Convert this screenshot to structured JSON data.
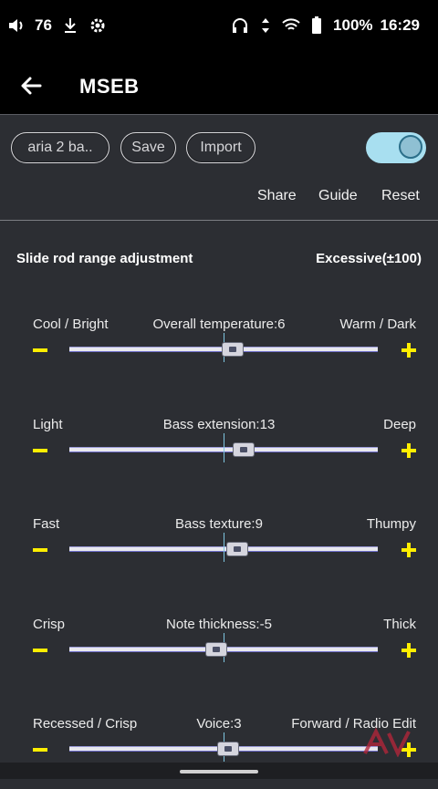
{
  "status_bar": {
    "volume_level": "76",
    "battery": "100%",
    "time": "16:29"
  },
  "app_bar": {
    "title": "MSEB"
  },
  "toolbar": {
    "preset_name": "aria 2 ba..",
    "save_label": "Save",
    "import_label": "Import",
    "toggle_on": true
  },
  "actions": {
    "share": "Share",
    "guide": "Guide",
    "reset": "Reset"
  },
  "range": {
    "label": "Slide rod range adjustment",
    "value": "Excessive(±100)"
  },
  "sliders": [
    {
      "left": "Cool / Bright",
      "center": "Overall temperature:6",
      "right": "Warm / Dark",
      "value": 6
    },
    {
      "left": "Light",
      "center": "Bass extension:13",
      "right": "Deep",
      "value": 13
    },
    {
      "left": "Fast",
      "center": "Bass texture:9",
      "right": "Thumpy",
      "value": 9
    },
    {
      "left": "Crisp",
      "center": "Note thickness:-5",
      "right": "Thick",
      "value": -5
    },
    {
      "left": "Recessed / Crisp",
      "center": "Voice:3",
      "right": "Forward / Radio Edit",
      "value": 3
    }
  ],
  "slider_range": [
    -100,
    100
  ],
  "colors": {
    "accent_yellow": "#ffee00",
    "toggle": "#a8dff0",
    "background": "#2c2e33"
  },
  "icons": [
    "volume-icon",
    "download-icon",
    "settings-icon",
    "headset-icon",
    "wifi-icon",
    "battery-icon",
    "back-arrow-icon",
    "watermark-logo-icon"
  ]
}
